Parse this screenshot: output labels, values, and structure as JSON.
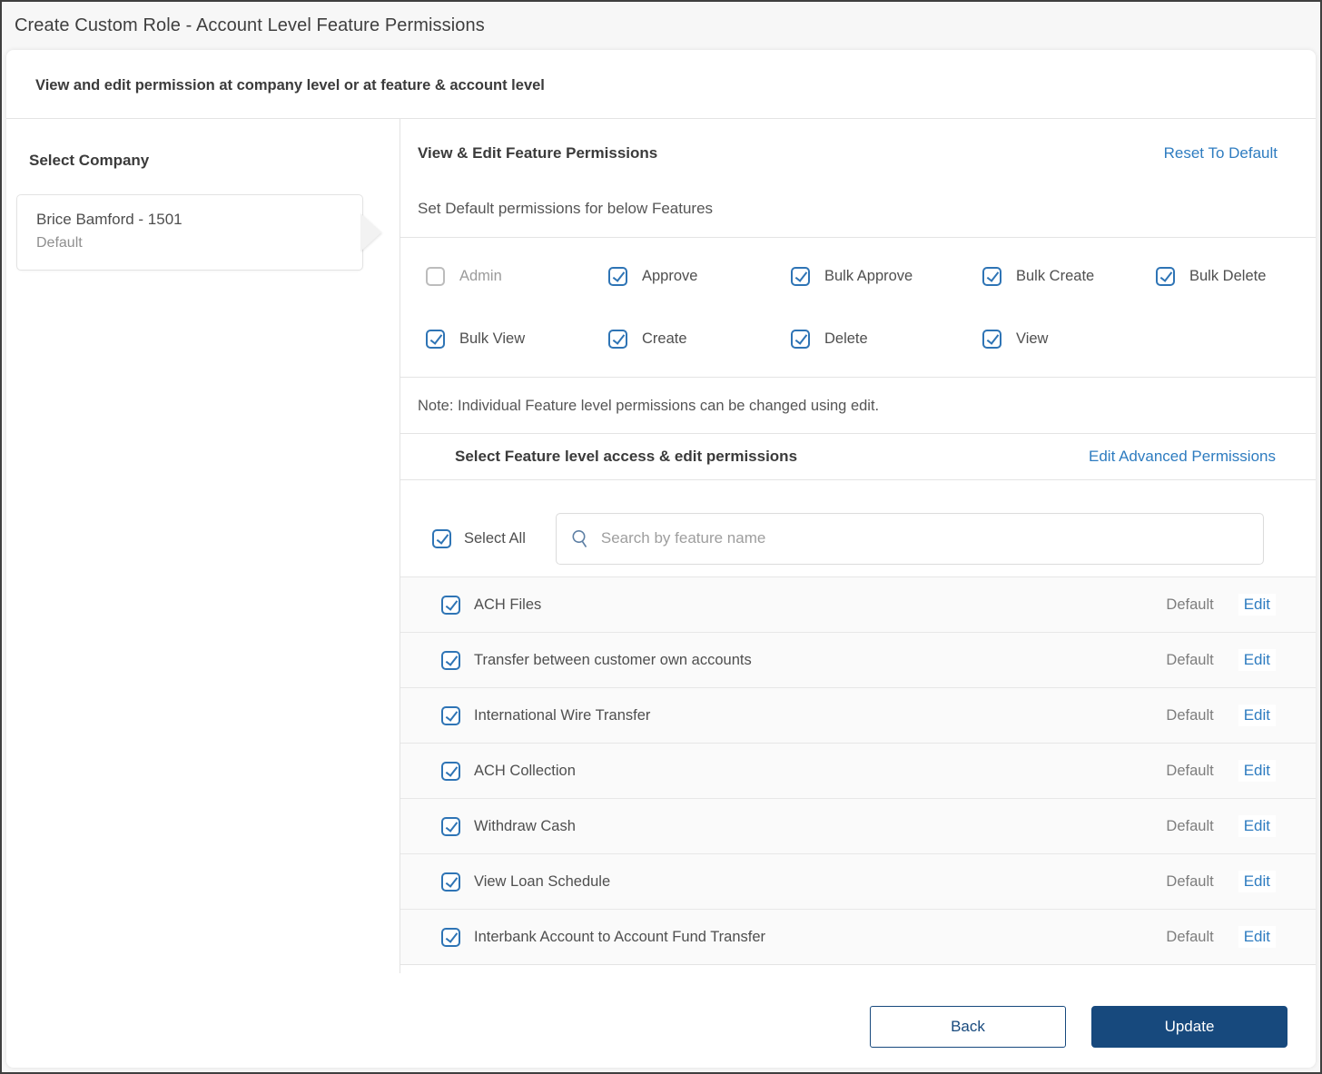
{
  "window": {
    "title": "Create Custom Role - Account Level Feature Permissions"
  },
  "intro": {
    "subtitle": "View and edit permission at company level or at feature & account level"
  },
  "company": {
    "heading": "Select Company",
    "name": "Brice Bamford  - 1501",
    "role": "Default"
  },
  "permissions": {
    "heading": "View & Edit Feature Permissions",
    "reset_link": "Reset To Default",
    "set_default_label": "Set Default permissions for below Features",
    "items": [
      {
        "label": "Admin",
        "checked": false
      },
      {
        "label": "Approve",
        "checked": true
      },
      {
        "label": "Bulk Approve",
        "checked": true
      },
      {
        "label": "Bulk Create",
        "checked": true
      },
      {
        "label": "Bulk Delete",
        "checked": true
      },
      {
        "label": "Bulk View",
        "checked": true
      },
      {
        "label": "Create",
        "checked": true
      },
      {
        "label": "Delete",
        "checked": true
      },
      {
        "label": "View",
        "checked": true
      }
    ],
    "note": "Note: Individual Feature level permissions can be changed using edit."
  },
  "features": {
    "heading": "Select Feature level access & edit permissions",
    "advanced_link": "Edit Advanced Permissions",
    "select_all_label": "Select All",
    "search_placeholder": "Search by feature name",
    "rows": [
      {
        "name": "ACH Files",
        "status": "Default",
        "action": "Edit",
        "checked": true
      },
      {
        "name": "Transfer between customer own accounts",
        "status": "Default",
        "action": "Edit",
        "checked": true
      },
      {
        "name": "International Wire Transfer",
        "status": "Default",
        "action": "Edit",
        "checked": true
      },
      {
        "name": "ACH Collection",
        "status": "Default",
        "action": "Edit",
        "checked": true
      },
      {
        "name": "Withdraw Cash",
        "status": "Default",
        "action": "Edit",
        "checked": true
      },
      {
        "name": "View Loan Schedule",
        "status": "Default",
        "action": "Edit",
        "checked": true
      },
      {
        "name": "Interbank Account to Account Fund Transfer",
        "status": "Default",
        "action": "Edit",
        "checked": true
      }
    ]
  },
  "footer": {
    "back_label": "Back",
    "update_label": "Update"
  },
  "colors": {
    "accent_blue": "#2e74b5",
    "link_blue": "#2e7cc0",
    "navy": "#17497d"
  }
}
